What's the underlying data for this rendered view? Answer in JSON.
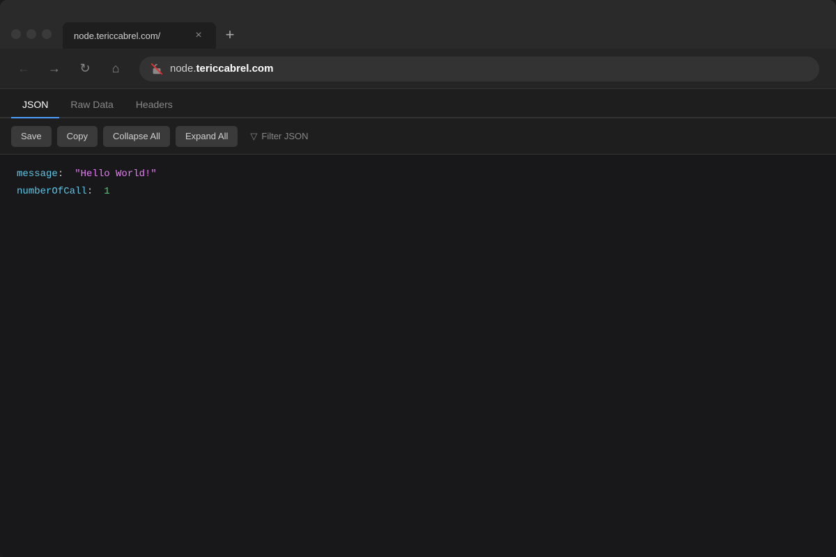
{
  "browser": {
    "tab": {
      "title": "node.tericcabrel.com/",
      "close_label": "×"
    },
    "new_tab_label": "+",
    "nav": {
      "back_label": "←",
      "forward_label": "→",
      "refresh_label": "↻",
      "home_label": "⌂",
      "address": {
        "domain_prefix": "node.",
        "domain_main": "tericcabrel.com"
      }
    }
  },
  "viewer": {
    "tabs": [
      {
        "label": "JSON",
        "active": true
      },
      {
        "label": "Raw Data",
        "active": false
      },
      {
        "label": "Headers",
        "active": false
      }
    ],
    "toolbar": {
      "save_label": "Save",
      "copy_label": "Copy",
      "collapse_label": "Collapse All",
      "expand_label": "Expand All",
      "filter_icon": "▽",
      "filter_label": "Filter JSON"
    },
    "json": {
      "rows": [
        {
          "key": "message",
          "value_type": "string",
          "value": "\"Hello World!\""
        },
        {
          "key": "numberOfCall",
          "value_type": "number",
          "value": "1"
        }
      ]
    }
  }
}
